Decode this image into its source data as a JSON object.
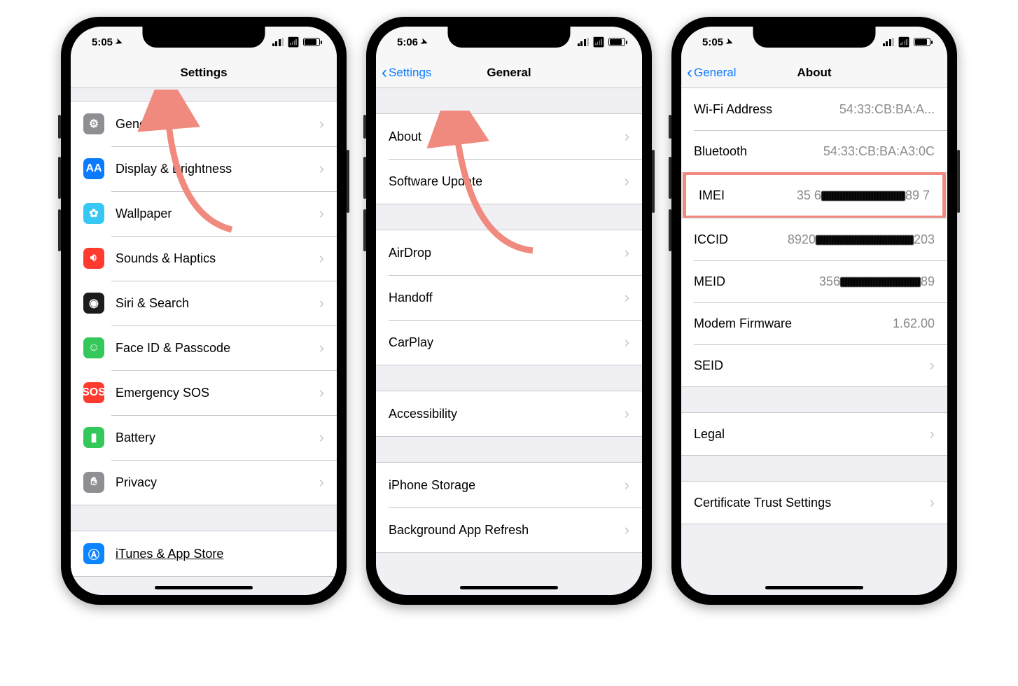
{
  "phones": {
    "settings": {
      "time": "5:05",
      "title": "Settings",
      "items": [
        {
          "label": "General",
          "icon": "gear"
        },
        {
          "label": "Display & Brightness",
          "icon": "display"
        },
        {
          "label": "Wallpaper",
          "icon": "wallpaper"
        },
        {
          "label": "Sounds & Haptics",
          "icon": "sounds"
        },
        {
          "label": "Siri & Search",
          "icon": "siri"
        },
        {
          "label": "Face ID & Passcode",
          "icon": "faceid"
        },
        {
          "label": "Emergency SOS",
          "icon": "sos"
        },
        {
          "label": "Battery",
          "icon": "battery"
        },
        {
          "label": "Privacy",
          "icon": "privacy"
        },
        {
          "label": "iTunes & App Store",
          "icon": "itunes"
        }
      ]
    },
    "general": {
      "time": "5:06",
      "back": "Settings",
      "title": "General",
      "group1": [
        "About",
        "Software Update"
      ],
      "group2": [
        "AirDrop",
        "Handoff",
        "CarPlay"
      ],
      "group3": [
        "Accessibility"
      ],
      "group4": [
        "iPhone Storage",
        "Background App Refresh"
      ]
    },
    "about": {
      "time": "5:05",
      "back": "General",
      "title": "About",
      "rows": {
        "wifi": {
          "label": "Wi-Fi Address",
          "value": "54:33:CB:BA:A..."
        },
        "bt": {
          "label": "Bluetooth",
          "value": "54:33:CB:BA:A3:0C"
        },
        "imei": {
          "label": "IMEI",
          "prefix": "35 6",
          "suffix": "89 7"
        },
        "iccid": {
          "label": "ICCID",
          "prefix": "8920",
          "suffix": "203"
        },
        "meid": {
          "label": "MEID",
          "prefix": "356",
          "suffix": "89"
        },
        "modem": {
          "label": "Modem Firmware",
          "value": "1.62.00"
        },
        "seid": {
          "label": "SEID"
        },
        "legal": {
          "label": "Legal"
        },
        "cert": {
          "label": "Certificate Trust Settings"
        }
      }
    }
  }
}
